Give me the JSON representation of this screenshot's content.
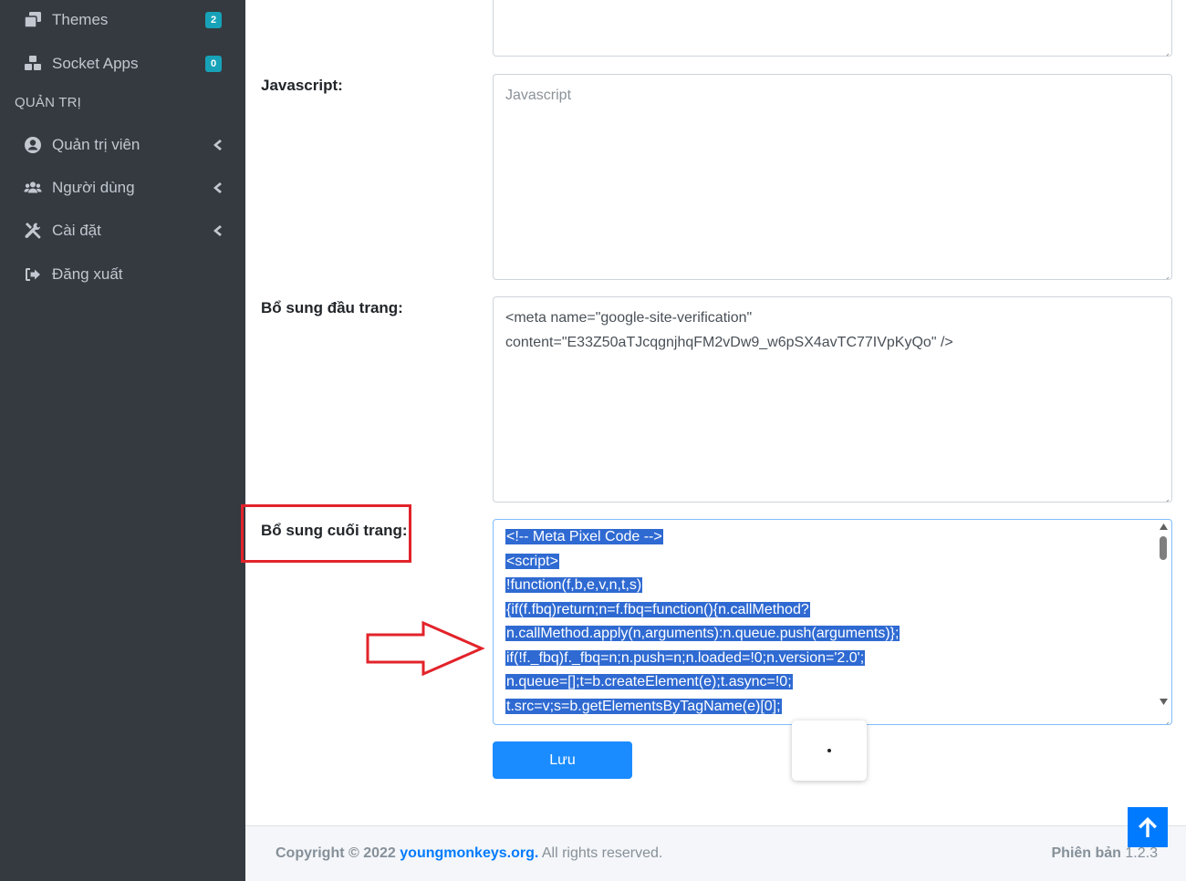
{
  "sidebar": {
    "items": [
      {
        "label": "Themes",
        "icon": "window-restore-icon",
        "badge": "2"
      },
      {
        "label": "Socket Apps",
        "icon": "cubes-icon",
        "badge": "0"
      }
    ],
    "section_header": "QUẢN TRỊ",
    "admin_items": [
      {
        "label": "Quản trị viên",
        "icon": "user-circle-icon"
      },
      {
        "label": "Người dùng",
        "icon": "users-icon"
      },
      {
        "label": "Cài đặt",
        "icon": "tools-icon"
      },
      {
        "label": "Đăng xuất",
        "icon": "sign-out-icon"
      }
    ]
  },
  "form": {
    "javascript_label": "Javascript:",
    "javascript_placeholder": "Javascript",
    "header_label": "Bổ sung đầu trang:",
    "header_value_lines": [
      "<meta name=\"google-site-verification\"",
      "content=\"E33Z50aTJcqgnjhqFM2vDw9_w6pSX4avTC77IVpKyQo\" />"
    ],
    "footer_label": "Bổ sung cuối trang:",
    "footer_code_lines": [
      "<!-- Meta Pixel Code -->",
      "<script>",
      "!function(f,b,e,v,n,t,s)",
      "{if(f.fbq)return;n=f.fbq=function(){n.callMethod?",
      "n.callMethod.apply(n,arguments):n.queue.push(arguments)};",
      "if(!f._fbq)f._fbq=n;n.push=n;n.loaded=!0;n.version='2.0';",
      "n.queue=[];t=b.createElement(e);t.async=!0;",
      "t.src=v;s=b.getElementsByTagName(e)[0];"
    ],
    "save_label": "Lưu"
  },
  "footer": {
    "copyright_prefix": "Copyright © 2022",
    "copyright_link": "youngmonkeys.org.",
    "copyright_suffix": "All rights reserved.",
    "version_label": "Phiên bản",
    "version_value": "1.2.3"
  },
  "colors": {
    "sidebar_bg": "#343a40",
    "badge": "#17a2b8",
    "primary": "#1a8cff",
    "annotation": "#e2232a",
    "selection": "#2f6ad2"
  }
}
